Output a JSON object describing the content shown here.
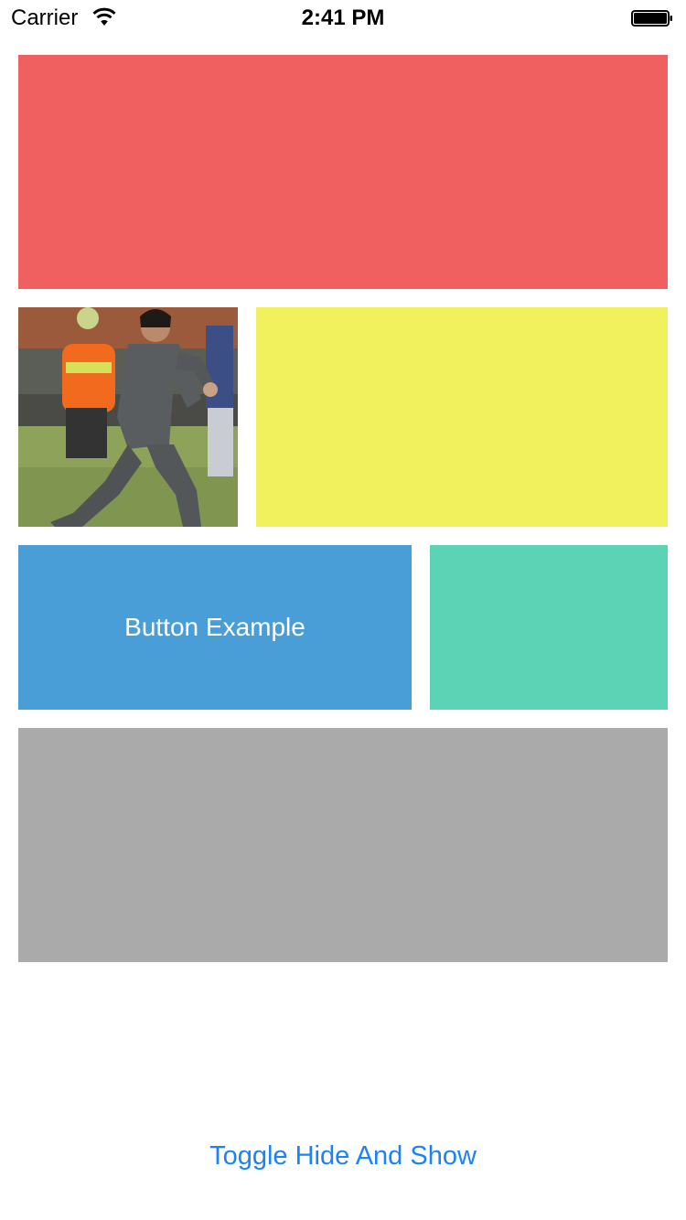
{
  "status_bar": {
    "carrier": "Carrier",
    "time": "2:41 PM",
    "wifi_icon": "wifi-icon",
    "battery_icon": "battery-icon"
  },
  "colors": {
    "red": "#F16061",
    "yellow": "#F1F15E",
    "blue": "#4A9ED8",
    "green": "#5CD3B4",
    "gray": "#AAAAAA",
    "link": "#1A82FB"
  },
  "photo": {
    "description_icon": "photo-image"
  },
  "button_example": {
    "label": "Button Example"
  },
  "toggle": {
    "label": "Toggle Hide And Show"
  }
}
